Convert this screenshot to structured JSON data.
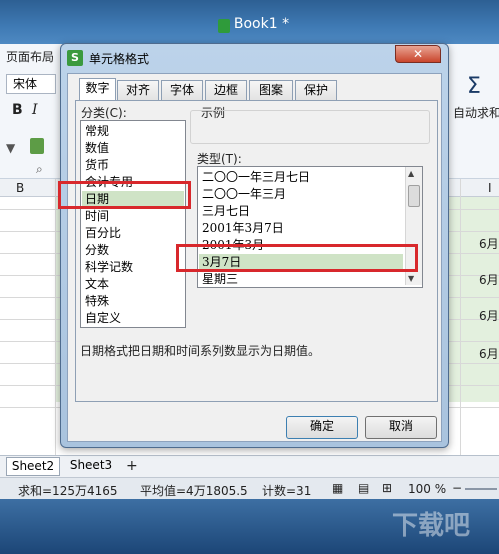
{
  "window": {
    "title": "Book1 *"
  },
  "ribbon": {
    "tab_page_layout": "页面布局",
    "font_name": "宋体",
    "bold": "B",
    "italic": "I",
    "sigma": "Σ",
    "autosum": "自动求和"
  },
  "sheet": {
    "col_b": "B",
    "col_i": "I",
    "cells_right": [
      "6月",
      "6月",
      "6月2",
      "6月2"
    ]
  },
  "sheet_tabs": {
    "tab2": "Sheet2",
    "tab3": "Sheet3",
    "add": "+"
  },
  "status": {
    "sum": "求和=125万4165",
    "avg": "平均值=4万1805.5",
    "count": "计数=31",
    "zoom": "100 %"
  },
  "dialog": {
    "title": "单元格格式",
    "close": "✕",
    "tabs": [
      "数字",
      "对齐",
      "字体",
      "边框",
      "图案",
      "保护"
    ],
    "category_label": "分类(C):",
    "categories": [
      "常规",
      "数值",
      "货币",
      "会计专用",
      "日期",
      "时间",
      "百分比",
      "分数",
      "科学记数",
      "文本",
      "特殊",
      "自定义"
    ],
    "selected_category": "日期",
    "sample_label": "示例",
    "type_label": "类型(T):",
    "types": [
      "二〇〇一年三月七日",
      "二〇〇一年三月",
      "三月七日",
      "2001年3月7日",
      "2001年3月",
      "3月7日",
      "星期三"
    ],
    "selected_type": "3月7日",
    "description": "日期格式把日期和时间系列数显示为日期值。",
    "ok": "确定",
    "cancel": "取消"
  },
  "watermark": "下载吧"
}
